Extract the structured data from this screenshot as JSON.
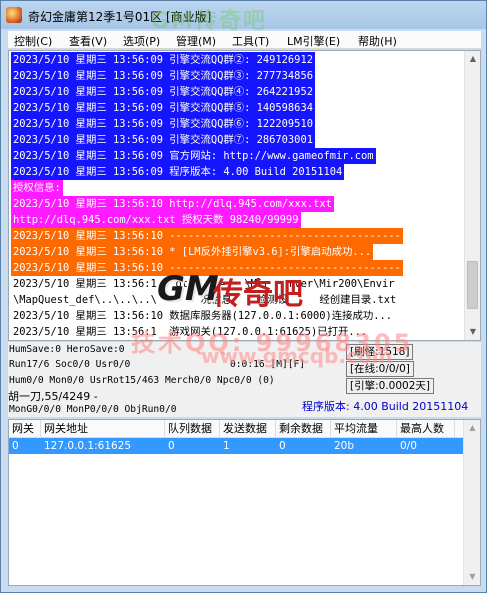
{
  "window": {
    "title": "奇幻金庸第12季1号01区 [商业版]",
    "watermark_top": "GM传奇吧"
  },
  "menu": [
    {
      "label": "控制(C)"
    },
    {
      "label": "查看(V)"
    },
    {
      "label": "选项(P)"
    },
    {
      "label": "管理(M)"
    },
    {
      "label": "工具(T)"
    },
    {
      "label": "LM引擎(E)"
    },
    {
      "label": "帮助(H)"
    }
  ],
  "log": [
    {
      "text": "2023/5/10 星期三 13:56:09 引擎交流QQ群②: 249126912",
      "style": "blue"
    },
    {
      "text": "2023/5/10 星期三 13:56:09 引擎交流QQ群③: 277734856",
      "style": "blue"
    },
    {
      "text": "2023/5/10 星期三 13:56:09 引擎交流QQ群④: 264221952",
      "style": "blue"
    },
    {
      "text": "2023/5/10 星期三 13:56:09 引擎交流QQ群⑤: 140598634",
      "style": "blue"
    },
    {
      "text": "2023/5/10 星期三 13:56:09 引擎交流QQ群⑥: 122209510",
      "style": "blue"
    },
    {
      "text": "2023/5/10 星期三 13:56:09 引擎交流QQ群⑦: 286703001",
      "style": "blue"
    },
    {
      "text": "2023/5/10 星期三 13:56:09 官方网站: http://www.gameofmir.com",
      "style": "blue"
    },
    {
      "text": "2023/5/10 星期三 13:56:09 程序版本: 4.00 Build 20151104",
      "style": "blue"
    },
    {
      "text": "授权信息:",
      "style": "magenta"
    },
    {
      "text": "2023/5/10 星期三 13:56:10 http://dlq.945.com/xxx.txt",
      "style": "magenta"
    },
    {
      "text": "http://dlq.945.com/xxx.txt 授权天数 98240/99999",
      "style": "magenta"
    },
    {
      "text": "2023/5/10 星期三 13:56:10 -------------------------------------",
      "style": "orange"
    },
    {
      "text": "2023/5/10 星期三 13:56:10 * [LM反外挂引擎v3.6]:引擎启动成功...",
      "style": "orange"
    },
    {
      "text": "2023/5/10 星期三 13:56:10 -------------------------------------",
      "style": "orange"
    },
    {
      "text": "2023/5/10 星期三 13:56:1   ot     =   \\Mir   rver\\Mir200\\Envir",
      "style": "plain"
    },
    {
      "text": "\\MapQuest_def\\..\\..\\..\\       况信息    检测设     经创建目录.txt",
      "style": "plain"
    },
    {
      "text": "2023/5/10 星期三 13:56:10 数据库服务器(127.0.0.1:6000)连接成功...",
      "style": "plain"
    },
    {
      "text": "2023/5/10 星期三 13:56:1  游戏网关(127.0.0.1:61625)已打开...",
      "style": "plain"
    }
  ],
  "watermarks": {
    "gm": "GM",
    "title": "传奇吧",
    "qq": "技术QQ: 99968305",
    "site": "www.gmcqb.com"
  },
  "status": {
    "line1": "HumSave:0 HeroSave:0",
    "line2": "Run17/6 Soc0/0 Usr0/0",
    "timer": "0:0:16 [M][F]",
    "line3": "Hum0/0 Mon0/0 UsrRot15/463 Merch0/0 Npc0/0 (0)",
    "line4": "胡一刀,55/4249 -",
    "line5": "MonG0/0/0 MonP0/0/0 ObjRun0/0",
    "refresh": "[刷怪:1518]",
    "online": "[在线:0/0/0]",
    "engine": "[引擎:0.0002天]",
    "version": "程序版本: 4.00 Build 20151104"
  },
  "table": {
    "columns": [
      "网关",
      "网关地址",
      "队列数据",
      "发送数据",
      "剩余数据",
      "平均流量",
      "最高人数"
    ],
    "rows": [
      [
        "0",
        "127.0.0.1:61625",
        "0",
        "1",
        "0",
        "20b",
        "0/0"
      ]
    ]
  }
}
